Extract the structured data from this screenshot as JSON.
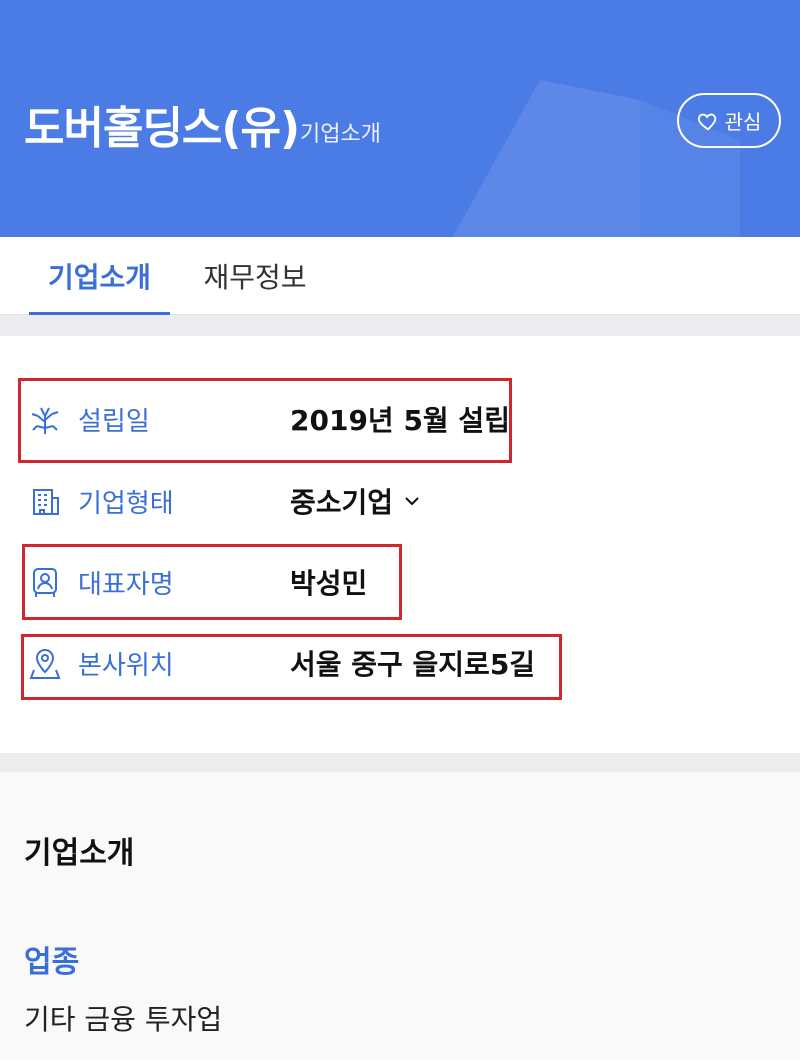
{
  "header": {
    "company_name": "도버홀딩스(유)",
    "subtitle": "기업소개",
    "favorite_label": "관심",
    "bg_color": "#4b7be5"
  },
  "tabs": [
    {
      "label": "기업소개",
      "active": true
    },
    {
      "label": "재무정보",
      "active": false
    }
  ],
  "info_rows": [
    {
      "icon": "tree-icon",
      "label": "설립일",
      "value": "2019년 5월 설립",
      "highlighted": true
    },
    {
      "icon": "building-icon",
      "label": "기업형태",
      "value": "중소기업",
      "has_dropdown": true,
      "highlighted": false
    },
    {
      "icon": "person-icon",
      "label": "대표자명",
      "value": "박성민",
      "highlighted": true
    },
    {
      "icon": "location-pin-icon",
      "label": "본사위치",
      "value": "서울 중구 을지로5길",
      "highlighted": true
    }
  ],
  "intro": {
    "title": "기업소개",
    "industry_label": "업종",
    "industry_value": "기타 금융 투자업"
  },
  "colors": {
    "accent": "#3b6fd8",
    "highlight_box": "#d2262f"
  }
}
